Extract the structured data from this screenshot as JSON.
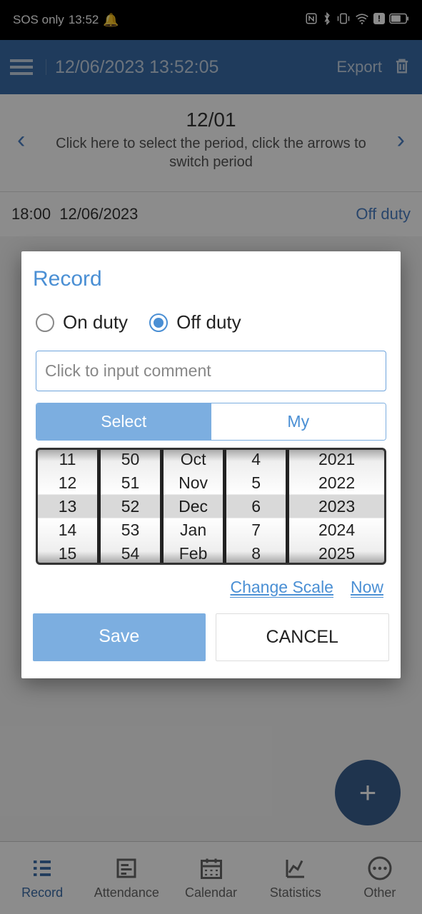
{
  "status_bar": {
    "left_text": "SOS only",
    "time": "13:52"
  },
  "header": {
    "datetime": "12/06/2023  13:52:05",
    "export_label": "Export"
  },
  "period": {
    "date": "12/01",
    "hint": "Click here to select the period, click the arrows to switch period"
  },
  "records": [
    {
      "time": "18:00",
      "date": "12/06/2023",
      "status": "Off duty"
    }
  ],
  "dialog": {
    "title": "Record",
    "radio_on": "On duty",
    "radio_off": "Off duty",
    "selected_radio": "off",
    "comment_placeholder": "Click to input comment",
    "toggle_select": "Select",
    "toggle_my": "My",
    "picker": {
      "hours": [
        "11",
        "12",
        "13",
        "14",
        "15"
      ],
      "minutes": [
        "50",
        "51",
        "52",
        "53",
        "54"
      ],
      "months": [
        "Oct",
        "Nov",
        "Dec",
        "Jan",
        "Feb"
      ],
      "days": [
        "4",
        "5",
        "6",
        "7",
        "8"
      ],
      "years": [
        "2021",
        "2022",
        "2023",
        "2024",
        "2025"
      ]
    },
    "link_change_scale": "Change Scale",
    "link_now": "Now",
    "save_label": "Save",
    "cancel_label": "CANCEL"
  },
  "nav": {
    "items": [
      {
        "label": "Record",
        "active": true
      },
      {
        "label": "Attendance",
        "active": false
      },
      {
        "label": "Calendar",
        "active": false
      },
      {
        "label": "Statistics",
        "active": false
      },
      {
        "label": "Other",
        "active": false
      }
    ]
  }
}
